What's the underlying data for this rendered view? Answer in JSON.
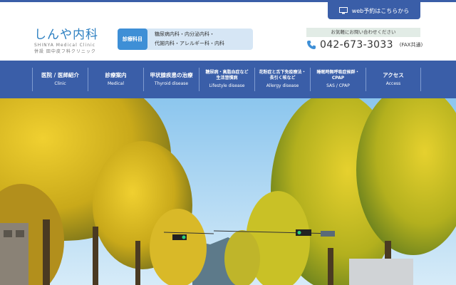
{
  "header": {
    "web_reservation_label": "web予約はこちらから",
    "logo_main": "しんや内科",
    "logo_sub": "SHINYA Medical Clinic",
    "logo_sub2": "併設 田中皮フ科クリニック",
    "dept_label": "診療科目",
    "dept_line1": "糖尿病内科・内分泌内科・",
    "dept_line2": "代謝内科・アレルギー科・内科",
    "contact_label": "お気軽にお問い合わせください",
    "phone": "042-673-3033",
    "fax_note": "(FAX共通)"
  },
  "nav": {
    "items": [
      {
        "jp": "医院 / 医師紹介",
        "en": "Clinic"
      },
      {
        "jp": "診療案内",
        "en": "Medical"
      },
      {
        "jp": "甲状腺疾患の治療",
        "en": "Thyroid disease"
      },
      {
        "jp": "糖尿病・高脂血症など",
        "jp2": "生活習慣病",
        "en": "Lifestyle disease"
      },
      {
        "jp": "花粉症と舌下免疫療法・",
        "jp2": "長引く咳など",
        "en": "Allergy disease"
      },
      {
        "jp": "睡眠時無呼吸症候群・",
        "jp2": "CPAP",
        "en": "SAS / CPAP"
      },
      {
        "jp": "アクセス",
        "en": "Access"
      }
    ]
  },
  "colors": {
    "brand_blue": "#3a5ea8",
    "logo_blue": "#2c7fc1",
    "dept_blue": "#3e8fd6"
  },
  "icons": {
    "web_reservation": "monitor-icon",
    "phone": "phone-icon"
  }
}
